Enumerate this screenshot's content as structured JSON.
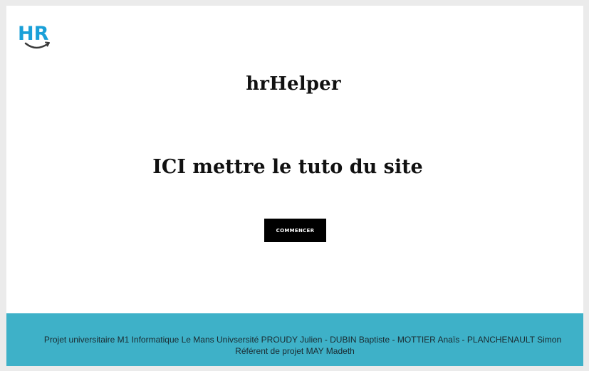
{
  "header": {
    "logo": {
      "text": "HR",
      "color": "#1aa0d8",
      "icon": "smile-arrow-icon"
    }
  },
  "main": {
    "title": "hrHelper",
    "tutorial_heading": "ICI mettre le tuto du site",
    "start_button_label": "COMMENCER"
  },
  "footer": {
    "line1": "Projet universitaire M1 Informatique Le Mans Univsersité PROUDY Julien - DUBIN Baptiste - MOTTIER Anaïs - PLANCHENAULT Simon",
    "line2": "Référent de projet MAY Madeth",
    "background_color": "#3eb1c8"
  }
}
